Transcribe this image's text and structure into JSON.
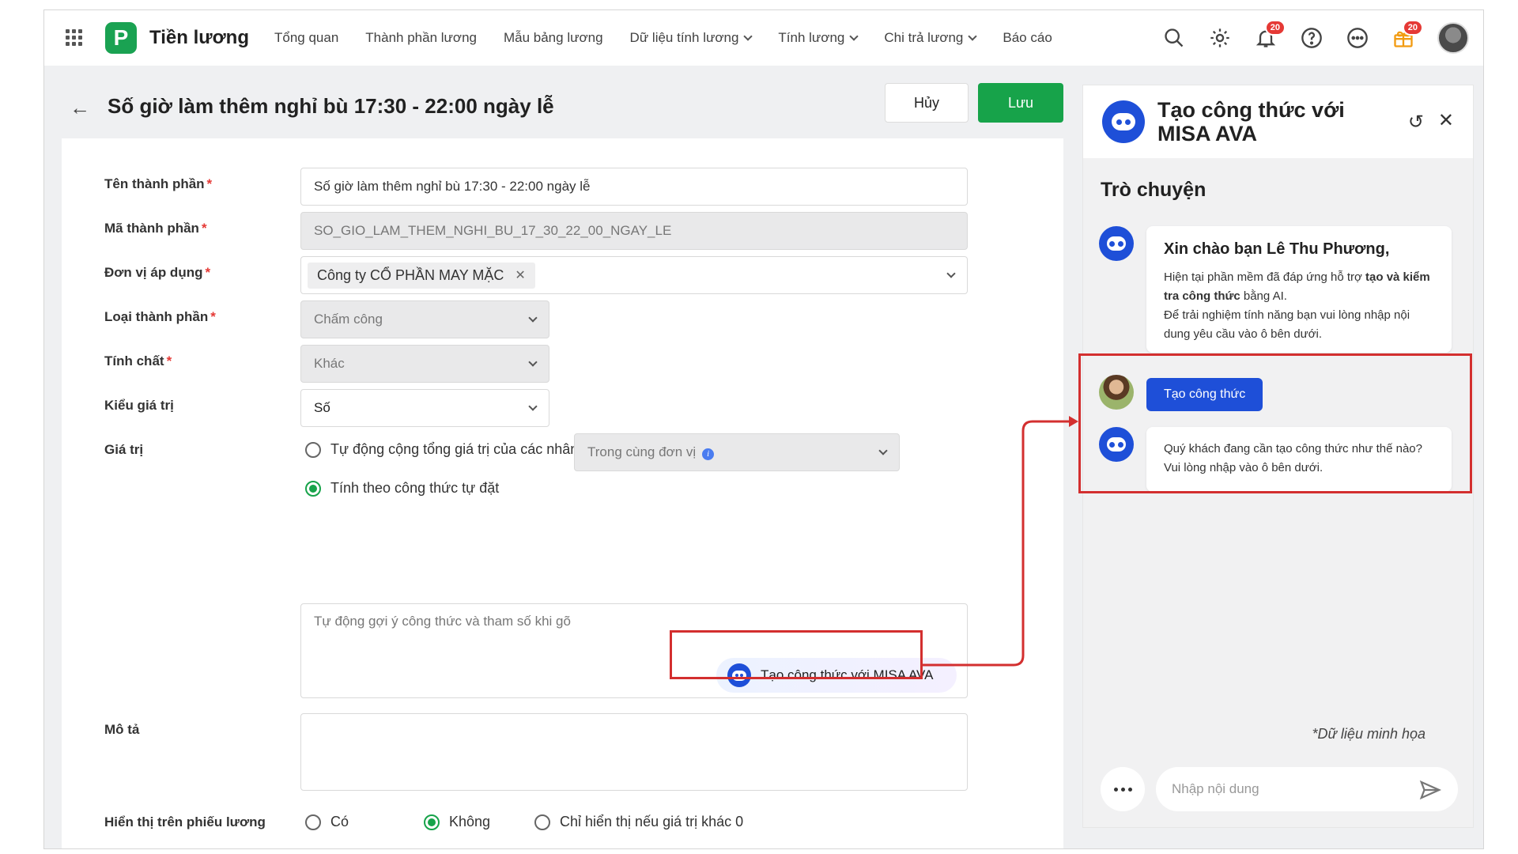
{
  "app": {
    "name": "Tiền lương",
    "logo_letter": "P",
    "accent": "#1aa252"
  },
  "nav": {
    "items": [
      {
        "label": "Tổng quan",
        "dropdown": false
      },
      {
        "label": "Thành phần lương",
        "dropdown": false
      },
      {
        "label": "Mẫu bảng lương",
        "dropdown": false
      },
      {
        "label": "Dữ liệu tính lương",
        "dropdown": true
      },
      {
        "label": "Tính lương",
        "dropdown": true
      },
      {
        "label": "Chi trả lương",
        "dropdown": true
      },
      {
        "label": "Báo cáo",
        "dropdown": false
      }
    ]
  },
  "topbar": {
    "notif_badge": "20",
    "gift_badge": "20",
    "icons": [
      "search-icon",
      "gear-icon",
      "bell-icon",
      "help-icon",
      "more-icon",
      "gift-icon",
      "avatar"
    ]
  },
  "header": {
    "title": "Số giờ làm thêm nghỉ bù 17:30 - 22:00 ngày lễ",
    "cancel_label": "Hủy",
    "save_label": "Lưu"
  },
  "form": {
    "name_label": "Tên thành phần",
    "name_value": "Số giờ làm thêm nghỉ bù 17:30 - 22:00 ngày lễ",
    "code_label": "Mã thành phần",
    "code_value": "SO_GIO_LAM_THEM_NGHI_BU_17_30_22_00_NGAY_LE",
    "unit_label": "Đơn vị áp dụng",
    "unit_chip": "Công ty CỔ PHẦN MAY MẶC",
    "type_label": "Loại thành phần",
    "type_value": "Chấm công",
    "nature_label": "Tính chất",
    "nature_value": "Khác",
    "valuetype_label": "Kiểu giá trị",
    "valuetype_value": "Số",
    "value_label": "Giá trị",
    "radio_auto": "Tự động cộng tổng giá trị của các nhân viên",
    "scope_value": "Trong cùng đơn vị",
    "radio_formula": "Tính theo công thức tự đặt",
    "formula_placeholder": "Tự động gợi ý công thức và tham số khi gõ",
    "ava_button": "Tạo công thức với MISA AVA",
    "desc_label": "Mô tả",
    "show_label": "Hiển thị trên phiếu lương",
    "show_options": [
      "Có",
      "Không",
      "Chỉ hiển thị nếu giá trị khác 0"
    ],
    "show_selected": "Không",
    "required_mark": "*"
  },
  "chat": {
    "title": "Tạo công thức với MISA AVA",
    "section": "Trò chuyện",
    "greeting": "Xin chào bạn Lê Thu Phương,",
    "intro_1": "Hiện tại phần mềm đã đáp ứng hỗ trợ ",
    "intro_bold": "tạo và kiểm tra công thức",
    "intro_2": " bằng AI.",
    "intro_3": "Để trải nghiệm tính năng bạn vui lòng nhập nội dung yêu cầu vào ô bên dưới.",
    "user_msg": "Tạo công thức",
    "bot_reply": "Quý khách đang cần tạo công thức như thế nào? Vui lòng nhập vào ô bên dưới.",
    "note": "*Dữ liệu minh họa",
    "input_placeholder": "Nhập nội dung",
    "bot_color": "#1e4fd8"
  },
  "annotation_color": "#d32f2f"
}
